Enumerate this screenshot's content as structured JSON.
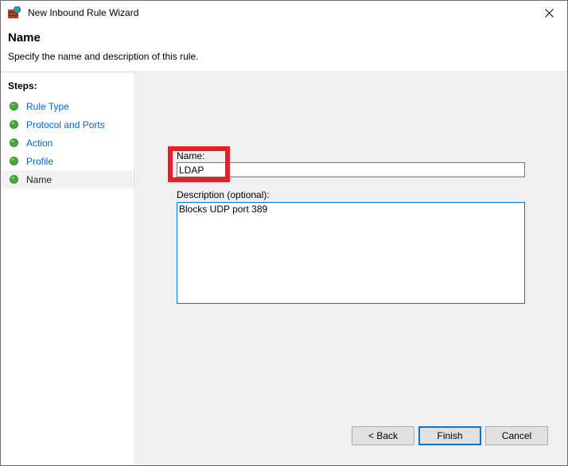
{
  "window": {
    "title": "New Inbound Rule Wizard",
    "icon": "firewall-globe-icon",
    "close_label": "✕"
  },
  "header": {
    "title": "Name",
    "subtitle": "Specify the name and description of this rule."
  },
  "sidebar": {
    "heading": "Steps:",
    "items": [
      {
        "label": "Rule Type",
        "current": false
      },
      {
        "label": "Protocol and Ports",
        "current": false
      },
      {
        "label": "Action",
        "current": false
      },
      {
        "label": "Profile",
        "current": false
      },
      {
        "label": "Name",
        "current": true
      }
    ]
  },
  "form": {
    "name_label": "Name:",
    "name_value": "LDAP",
    "name_placeholder": "",
    "description_label": "Description (optional):",
    "description_value": "Blocks UDP port 389",
    "description_placeholder": ""
  },
  "buttons": {
    "back": "< Back",
    "finish": "Finish",
    "cancel": "Cancel"
  },
  "colors": {
    "link": "#0066CC",
    "focus_border": "#0078D7",
    "annotation": "#ED1C24",
    "panel_bg": "#F0F0F0",
    "button_bg": "#E1E1E1"
  },
  "annotation": {
    "shape": "rectangle",
    "target": "name-field-group"
  }
}
